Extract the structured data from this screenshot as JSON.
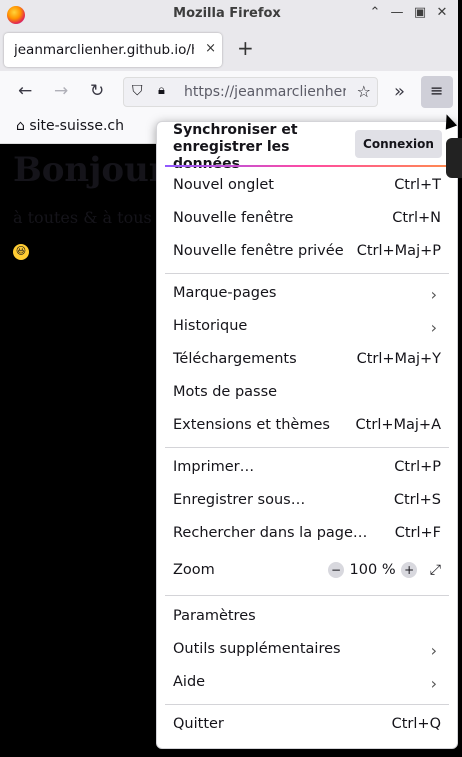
{
  "window": {
    "title": "Mozilla Firefox"
  },
  "tab": {
    "label": "jeanmarclienher.github.io/ht",
    "close": "×"
  },
  "toolbar": {
    "url": "https://jeanmarclienher"
  },
  "bookmarks": {
    "item": "site-suisse.ch"
  },
  "page": {
    "heading": "Bonjour",
    "text": "à toutes & à tous",
    "emoji": "😃"
  },
  "menu": {
    "sync_title": "Synchroniser et enregistrer les données",
    "connexion": "Connexion",
    "items": [
      {
        "label": "Nouvel onglet",
        "shortcut": "Ctrl+T"
      },
      {
        "label": "Nouvelle fenêtre",
        "shortcut": "Ctrl+N"
      },
      {
        "label": "Nouvelle fenêtre privée",
        "shortcut": "Ctrl+Maj+P"
      },
      {
        "label": "Marque-pages",
        "shortcut": ""
      },
      {
        "label": "Historique",
        "shortcut": ""
      },
      {
        "label": "Téléchargements",
        "shortcut": "Ctrl+Maj+Y"
      },
      {
        "label": "Mots de passe",
        "shortcut": ""
      },
      {
        "label": "Extensions et thèmes",
        "shortcut": "Ctrl+Maj+A"
      },
      {
        "label": "Imprimer…",
        "shortcut": "Ctrl+P"
      },
      {
        "label": "Enregistrer sous…",
        "shortcut": "Ctrl+S"
      },
      {
        "label": "Rechercher dans la page…",
        "shortcut": "Ctrl+F"
      },
      {
        "label": "Zoom",
        "shortcut": ""
      },
      {
        "label": "Paramètres",
        "shortcut": ""
      },
      {
        "label": "Outils supplémentaires",
        "shortcut": ""
      },
      {
        "label": "Aide",
        "shortcut": ""
      },
      {
        "label": "Quitter",
        "shortcut": "Ctrl+Q"
      }
    ],
    "zoom": {
      "value": "100 %",
      "minus": "−",
      "plus": "+"
    }
  }
}
